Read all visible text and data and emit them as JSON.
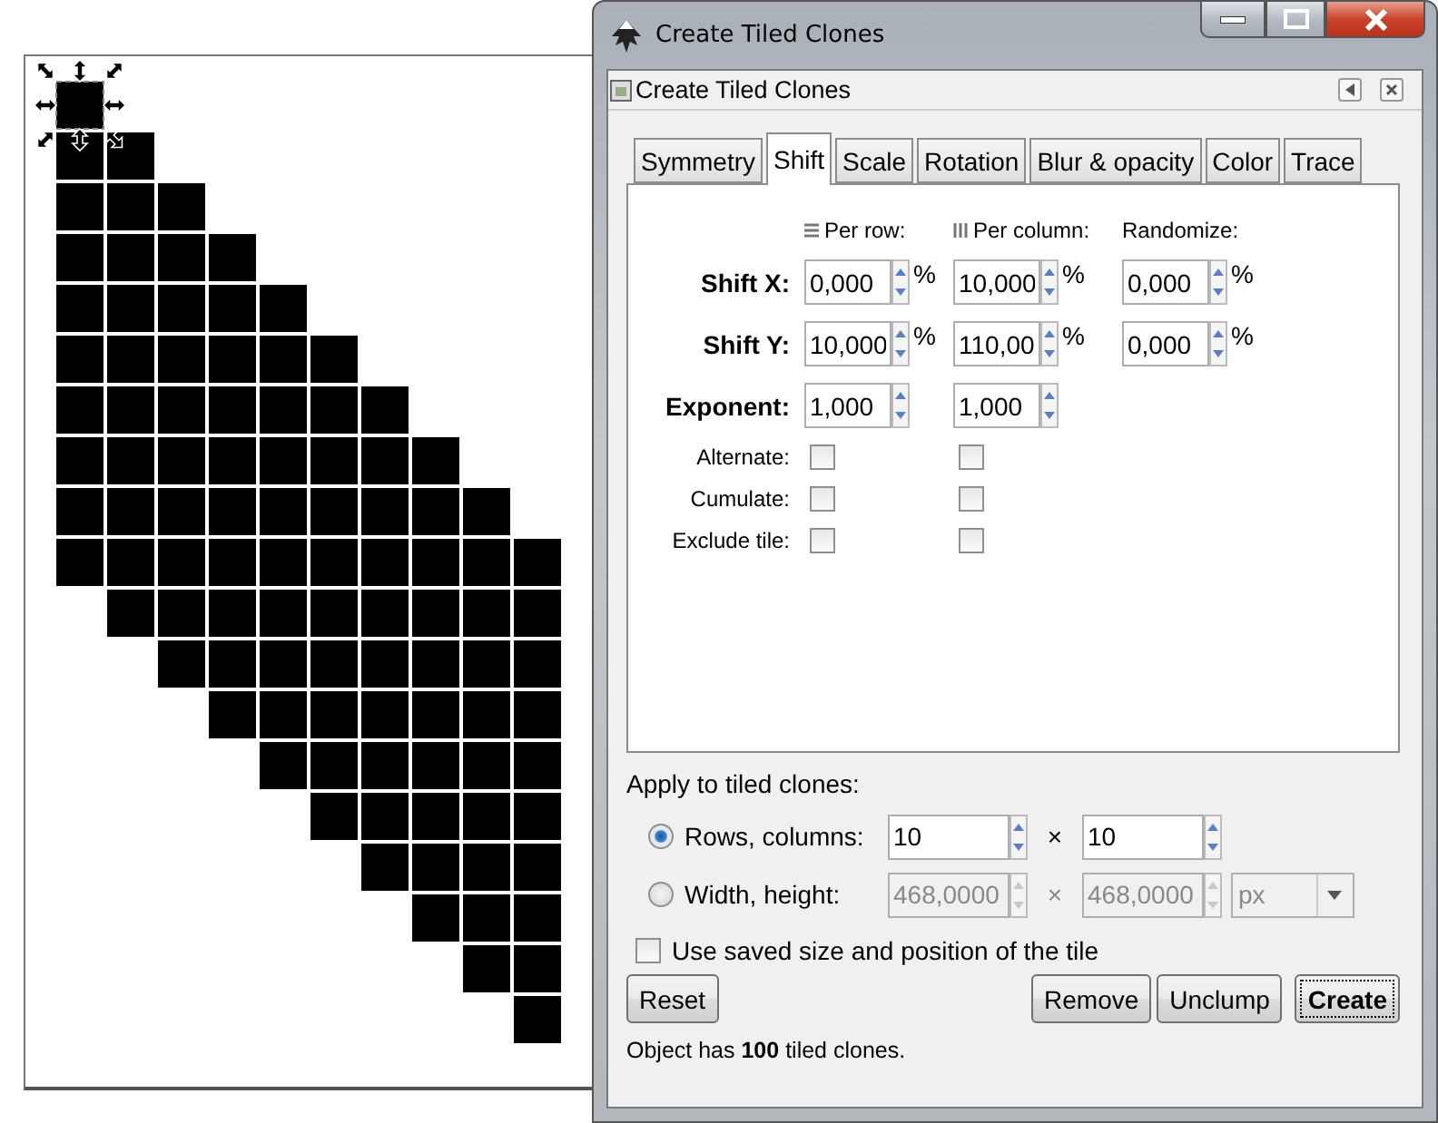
{
  "window": {
    "title": "Create Tiled Clones"
  },
  "panel": {
    "title": "Create Tiled Clones"
  },
  "tabs": [
    {
      "label": "Symmetry",
      "selected": false
    },
    {
      "label": "Shift",
      "selected": true
    },
    {
      "label": "Scale",
      "selected": false
    },
    {
      "label": "Rotation",
      "selected": false
    },
    {
      "label": "Blur & opacity",
      "selected": false
    },
    {
      "label": "Color",
      "selected": false
    },
    {
      "label": "Trace",
      "selected": false
    }
  ],
  "shift": {
    "columns": [
      {
        "label": "Per row:",
        "kind": "rows"
      },
      {
        "label": "Per column:",
        "kind": "columns"
      },
      {
        "label": "Randomize:",
        "kind": "plain"
      }
    ],
    "rows": [
      {
        "label": "Shift X:",
        "kind": "spin",
        "cells": [
          {
            "value": "0,000",
            "unit": "%"
          },
          {
            "value": "10,000",
            "unit": "%"
          },
          {
            "value": "0,000",
            "unit": "%"
          }
        ]
      },
      {
        "label": "Shift Y:",
        "kind": "spin",
        "cells": [
          {
            "value": "10,000",
            "unit": "%"
          },
          {
            "value": "110,00",
            "unit": "%"
          },
          {
            "value": "0,000",
            "unit": "%"
          }
        ]
      },
      {
        "label": "Exponent:",
        "kind": "spin",
        "cells": [
          {
            "value": "1,000"
          },
          {
            "value": "1,000"
          }
        ]
      },
      {
        "label": "Alternate:",
        "kind": "check",
        "cells": [
          {
            "checked": false
          },
          {
            "checked": false
          }
        ]
      },
      {
        "label": "Cumulate:",
        "kind": "check",
        "cells": [
          {
            "checked": false
          },
          {
            "checked": false
          }
        ]
      },
      {
        "label": "Exclude tile:",
        "kind": "check",
        "cells": [
          {
            "checked": false
          },
          {
            "checked": false
          }
        ]
      }
    ]
  },
  "apply": {
    "title": "Apply to tiled clones:",
    "options": [
      {
        "label": "Rows, columns:",
        "selected": true,
        "fields": [
          "10",
          "10"
        ],
        "times": "×"
      },
      {
        "label": "Width, height:",
        "selected": false,
        "fields": [
          "468,0000",
          "468,0000"
        ],
        "times": "×",
        "unit": "px"
      }
    ]
  },
  "use_saved": {
    "label": "Use saved size and position of the tile",
    "checked": false
  },
  "buttons": [
    {
      "label": "Reset",
      "kind": "left",
      "default": false
    },
    {
      "label": "Remove",
      "kind": "right",
      "default": false
    },
    {
      "label": "Unclump",
      "kind": "right",
      "default": false
    },
    {
      "label": "Create",
      "kind": "right",
      "default": true
    }
  ],
  "status": "Object has **100** tiled clones."
}
